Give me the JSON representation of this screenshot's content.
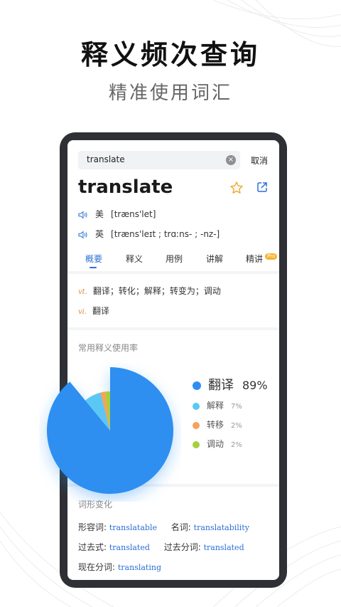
{
  "promo": {
    "title": "释义频次查询",
    "subtitle": "精准使用词汇"
  },
  "search": {
    "value": "translate",
    "cancel_label": "取消"
  },
  "entry": {
    "word": "translate",
    "pron_us_region": "美",
    "pron_us": "[træns'let]",
    "pron_uk_region": "英",
    "pron_uk": "[træns'leɪt ; trɑːns- ; -nz-]"
  },
  "tabs": [
    "概要",
    "释义",
    "用例",
    "讲解",
    "精讲"
  ],
  "pro_badge": "Pro",
  "definitions": [
    {
      "pos": "vt.",
      "text": "翻译；转化；解释；转变为；调动"
    },
    {
      "pos": "vi.",
      "text": "翻译"
    }
  ],
  "usage": {
    "title": "常用释义使用率",
    "chart_data": {
      "type": "pie",
      "categories": [
        "翻译",
        "解释",
        "转移",
        "调动"
      ],
      "values": [
        89,
        7,
        2,
        2
      ],
      "value_labels": [
        "89%",
        "7%",
        "2%",
        "2%"
      ],
      "colors": [
        "#2f8ff0",
        "#5bc7f5",
        "#f6a25a",
        "#a6cf3c"
      ]
    }
  },
  "forms": {
    "title": "词形变化",
    "adj_label": "形容词:",
    "adj_value": "translatable",
    "noun_label": "名词:",
    "noun_value": "translatability",
    "past_label": "过去式:",
    "past_value": "translated",
    "pp_label": "过去分词:",
    "pp_value": "translated",
    "pres_label": "现在分词:",
    "pres_value": "translating"
  },
  "icons": {
    "clear": "clear-icon",
    "star": "star-icon",
    "share": "share-icon",
    "speaker": "speaker-icon"
  }
}
